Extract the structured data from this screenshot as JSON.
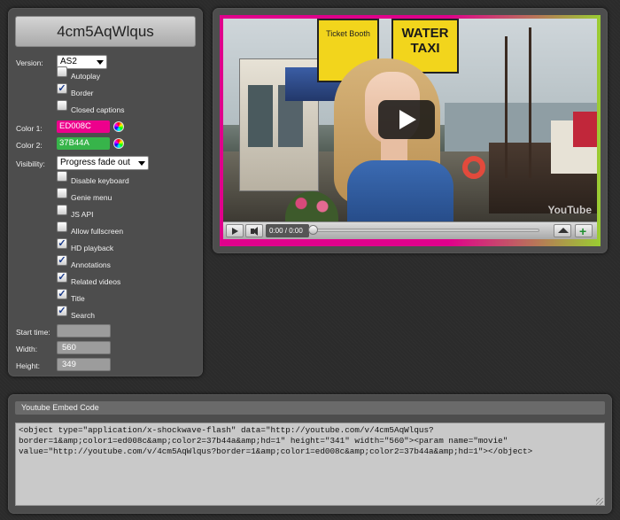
{
  "video_id": "4cm5AqWlqus",
  "settings": {
    "version_label": "Version:",
    "version_value": "AS2",
    "color1_label": "Color 1:",
    "color1_value": "ED008C",
    "color1_hex": "#ED008C",
    "color2_label": "Color 2:",
    "color2_value": "37B44A",
    "color2_hex": "#37B44A",
    "visibility_label": "Visibility:",
    "visibility_value": "Progress fade out",
    "start_time_label": "Start time:",
    "start_time_value": "",
    "width_label": "Width:",
    "width_value": "560",
    "height_label": "Height:",
    "height_value": "349",
    "checkboxes": [
      {
        "label": "Autoplay",
        "checked": false
      },
      {
        "label": "Border",
        "checked": true
      },
      {
        "label": "Closed captions",
        "checked": false
      },
      {
        "label": "Disable keyboard",
        "checked": false
      },
      {
        "label": "Genie menu",
        "checked": false
      },
      {
        "label": "JS API",
        "checked": false
      },
      {
        "label": "Allow fullscreen",
        "checked": false
      },
      {
        "label": "HD playback",
        "checked": true
      },
      {
        "label": "Annotations",
        "checked": true
      },
      {
        "label": "Related videos",
        "checked": true
      },
      {
        "label": "Title",
        "checked": true
      },
      {
        "label": "Search",
        "checked": true
      }
    ]
  },
  "player": {
    "time": "0:00 / 0:00",
    "progress": 0,
    "watermark": "YouTube",
    "sign_water": "WATER",
    "sign_taxi": "TAXI",
    "sign_booth": "Ticket Booth"
  },
  "embed": {
    "header": "Youtube Embed Code",
    "code": "<object type=\"application/x-shockwave-flash\" data=\"http://youtube.com/v/4cm5AqWlqus?border=1&amp;color1=ed008c&amp;color2=37b44a&amp;hd=1\" height=\"341\" width=\"560\"><param name=\"movie\" value=\"http://youtube.com/v/4cm5AqWlqus?border=1&amp;color1=ed008c&amp;color2=37b44a&amp;hd=1\"></object>"
  }
}
